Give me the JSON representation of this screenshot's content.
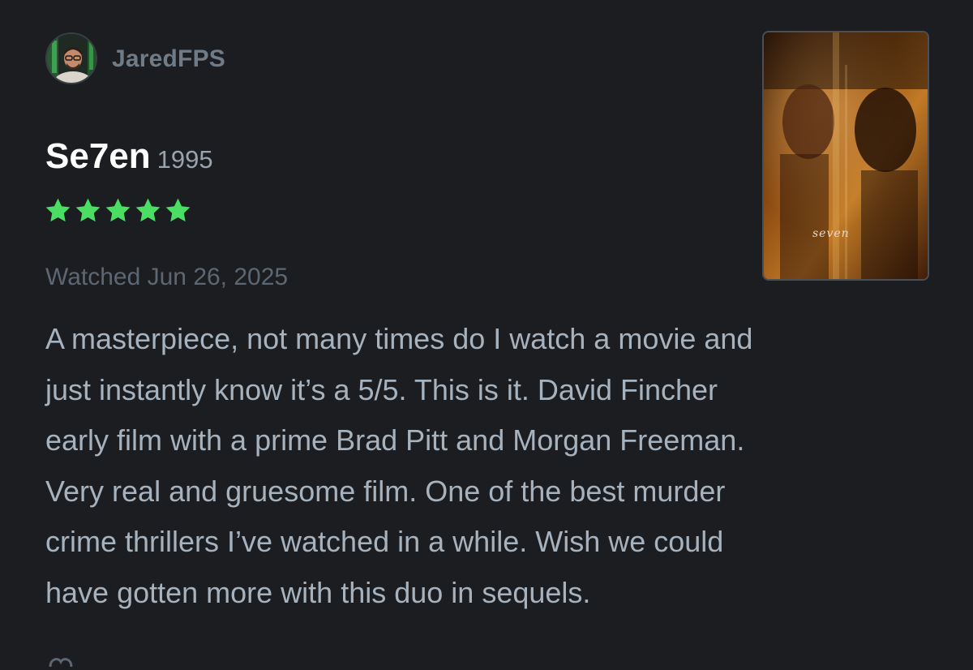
{
  "user": {
    "name": "JaredFPS",
    "avatar_icon": "user-avatar-icon"
  },
  "film": {
    "title": "Se7en",
    "year": "1995",
    "poster_title": "seven"
  },
  "rating": {
    "stars": 5,
    "max": 5,
    "color": "#4ade62"
  },
  "watched": "Watched Jun 26, 2025",
  "review": "A masterpiece, not many times do I watch a movie and\njust instantly know it’s a 5/5. This is it. David Fincher\nearly film with a prime Brad Pitt and Morgan Freeman.\nVery real and gruesome film. One of the best murder\ncrime thrillers I’ve watched in a while. Wish we could\nhave gotten more with this duo in sequels.",
  "colors": {
    "background": "#1b1d20",
    "username": "#6f7b86",
    "review_text": "#a6b2be",
    "meta_text": "#5d6773"
  }
}
